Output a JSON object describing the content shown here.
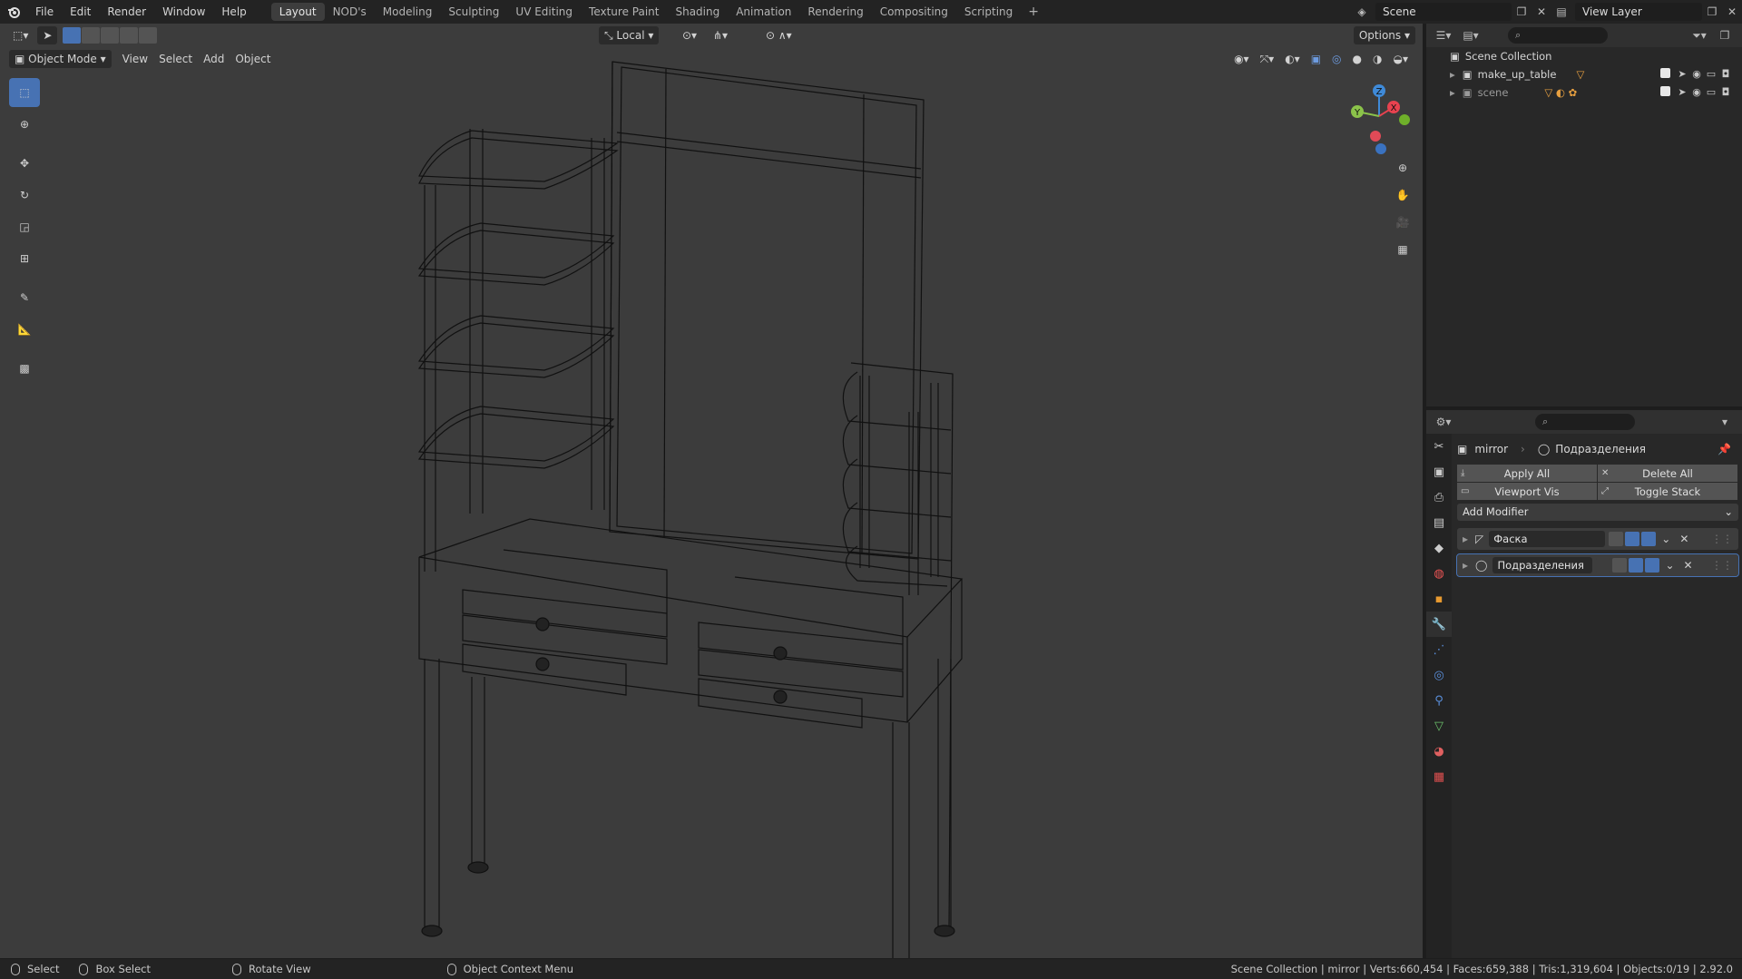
{
  "menu": {
    "file": "File",
    "edit": "Edit",
    "render": "Render",
    "window": "Window",
    "help": "Help"
  },
  "workspaces": [
    "Layout",
    "NOD's",
    "Modeling",
    "Sculpting",
    "UV Editing",
    "Texture Paint",
    "Shading",
    "Animation",
    "Rendering",
    "Compositing",
    "Scripting"
  ],
  "active_workspace": "Layout",
  "scene_name": "Scene",
  "view_layer": "View Layer",
  "viewport": {
    "mode": "Object Mode",
    "view": "View",
    "select": "Select",
    "add": "Add",
    "object": "Object",
    "transform_orientation": "Local",
    "options": "Options",
    "gizmo_axes": {
      "x": "X",
      "y": "Y",
      "z": "Z"
    }
  },
  "outliner": {
    "root": "Scene Collection",
    "items": [
      {
        "name": "make_up_table"
      },
      {
        "name": "scene"
      }
    ]
  },
  "properties": {
    "object": "mirror",
    "modifier": "Подразделения",
    "apply_all": "Apply All",
    "delete_all": "Delete All",
    "viewport_vis": "Viewport Vis",
    "toggle_stack": "Toggle Stack",
    "add_modifier": "Add Modifier",
    "modifiers": [
      {
        "name": "Фаска"
      },
      {
        "name": "Подразделения"
      }
    ]
  },
  "status": {
    "select": "Select",
    "box_select": "Box Select",
    "rotate_view": "Rotate View",
    "context_menu": "Object Context Menu",
    "stats": "Scene Collection | mirror | Verts:660,454 | Faces:659,388 | Tris:1,319,604 | Objects:0/19 | 2.92.0"
  },
  "colors": {
    "accent": "#4772b3",
    "viewport_bg": "#3c3c3c",
    "panel_bg": "#282828",
    "axis_x": "#e8424f",
    "axis_y": "#8bc34a",
    "axis_z": "#3f8ad8"
  }
}
